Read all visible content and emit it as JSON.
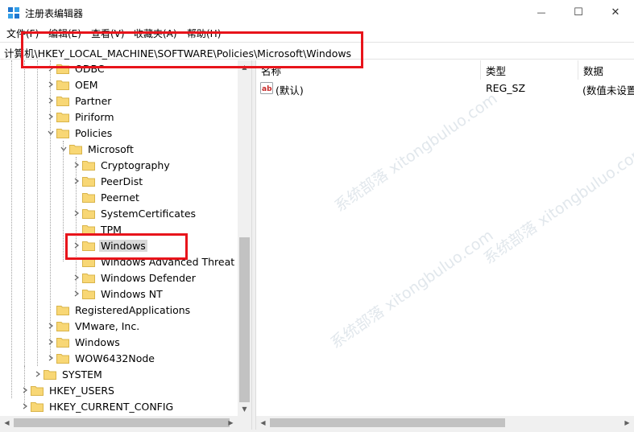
{
  "window": {
    "title": "注册表编辑器",
    "minimize_glyph": "—",
    "maximize_glyph": "☐",
    "close_glyph": "✕"
  },
  "menu": [
    "文件(F)",
    "编辑(E)",
    "查看(V)",
    "收藏夹(A)",
    "帮助(H)"
  ],
  "address": {
    "path": "计算机\\HKEY_LOCAL_MACHINE\\SOFTWARE\\Policies\\Microsoft\\Windows"
  },
  "tree": {
    "nodes": [
      {
        "label": "ODBC",
        "level": 3,
        "expander": ">"
      },
      {
        "label": "OEM",
        "level": 3,
        "expander": ">"
      },
      {
        "label": "Partner",
        "level": 3,
        "expander": ">"
      },
      {
        "label": "Piriform",
        "level": 3,
        "expander": ">"
      },
      {
        "label": "Policies",
        "level": 3,
        "expander": "v"
      },
      {
        "label": "Microsoft",
        "level": 4,
        "expander": "v"
      },
      {
        "label": "Cryptography",
        "level": 5,
        "expander": ">"
      },
      {
        "label": "PeerDist",
        "level": 5,
        "expander": ">"
      },
      {
        "label": "Peernet",
        "level": 5,
        "expander": ""
      },
      {
        "label": "SystemCertificates",
        "level": 5,
        "expander": ">"
      },
      {
        "label": "TPM",
        "level": 5,
        "expander": ""
      },
      {
        "label": "Windows",
        "level": 5,
        "expander": ">",
        "selected": true
      },
      {
        "label": "Windows Advanced Threat Pr",
        "level": 5,
        "expander": ""
      },
      {
        "label": "Windows Defender",
        "level": 5,
        "expander": ">"
      },
      {
        "label": "Windows NT",
        "level": 5,
        "expander": ">"
      },
      {
        "label": "RegisteredApplications",
        "level": 3,
        "expander": ""
      },
      {
        "label": "VMware, Inc.",
        "level": 3,
        "expander": ">"
      },
      {
        "label": "Windows",
        "level": 3,
        "expander": ">"
      },
      {
        "label": "WOW6432Node",
        "level": 3,
        "expander": ">"
      },
      {
        "label": "SYSTEM",
        "level": 2,
        "expander": ">"
      },
      {
        "label": "HKEY_USERS",
        "level": 1,
        "expander": ">"
      },
      {
        "label": "HKEY_CURRENT_CONFIG",
        "level": 1,
        "expander": ">"
      }
    ]
  },
  "list": {
    "columns": [
      "名称",
      "类型",
      "数据"
    ],
    "rows": [
      {
        "name": "(默认)",
        "type": "REG_SZ",
        "data": "(数值未设置"
      }
    ]
  },
  "watermark": "系统部落 xitongbuluo.com",
  "colors": {
    "highlight_red": "#e8141b",
    "folder_yellow": "#f8d775",
    "selected_bg": "#d9d9d9"
  }
}
